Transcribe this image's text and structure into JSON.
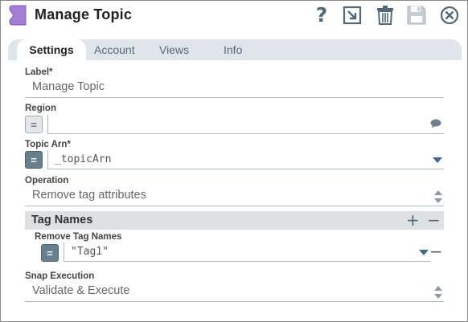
{
  "header": {
    "title": "Manage Topic",
    "help_label": "?"
  },
  "tabs": [
    {
      "label": "Settings",
      "active": true
    },
    {
      "label": "Account",
      "active": false
    },
    {
      "label": "Views",
      "active": false
    },
    {
      "label": "Info",
      "active": false
    }
  ],
  "fields": {
    "label": {
      "label": "Label*",
      "value": "Manage Topic"
    },
    "region": {
      "label": "Region",
      "value": "",
      "expr_symbol": "="
    },
    "topic_arn": {
      "label": "Topic Arn*",
      "value": "_topicArn",
      "expr_symbol": "="
    },
    "operation": {
      "label": "Operation",
      "value": "Remove tag attributes"
    },
    "tag_names": {
      "title": "Tag Names",
      "add_symbol": "+",
      "remove_symbol": "−",
      "column_label": "Remove Tag Names",
      "rows": [
        {
          "value": "\"Tag1\"",
          "expr_symbol": "=",
          "remove_symbol": "−"
        }
      ]
    },
    "snap_execution": {
      "label": "Snap Execution",
      "value": "Validate & Execute"
    }
  },
  "colors": {
    "icon_blue": "#50697a",
    "tab_bg": "#dfe5ea",
    "snap_icon": "#a47ed6",
    "expr_active": "#687f8e"
  }
}
